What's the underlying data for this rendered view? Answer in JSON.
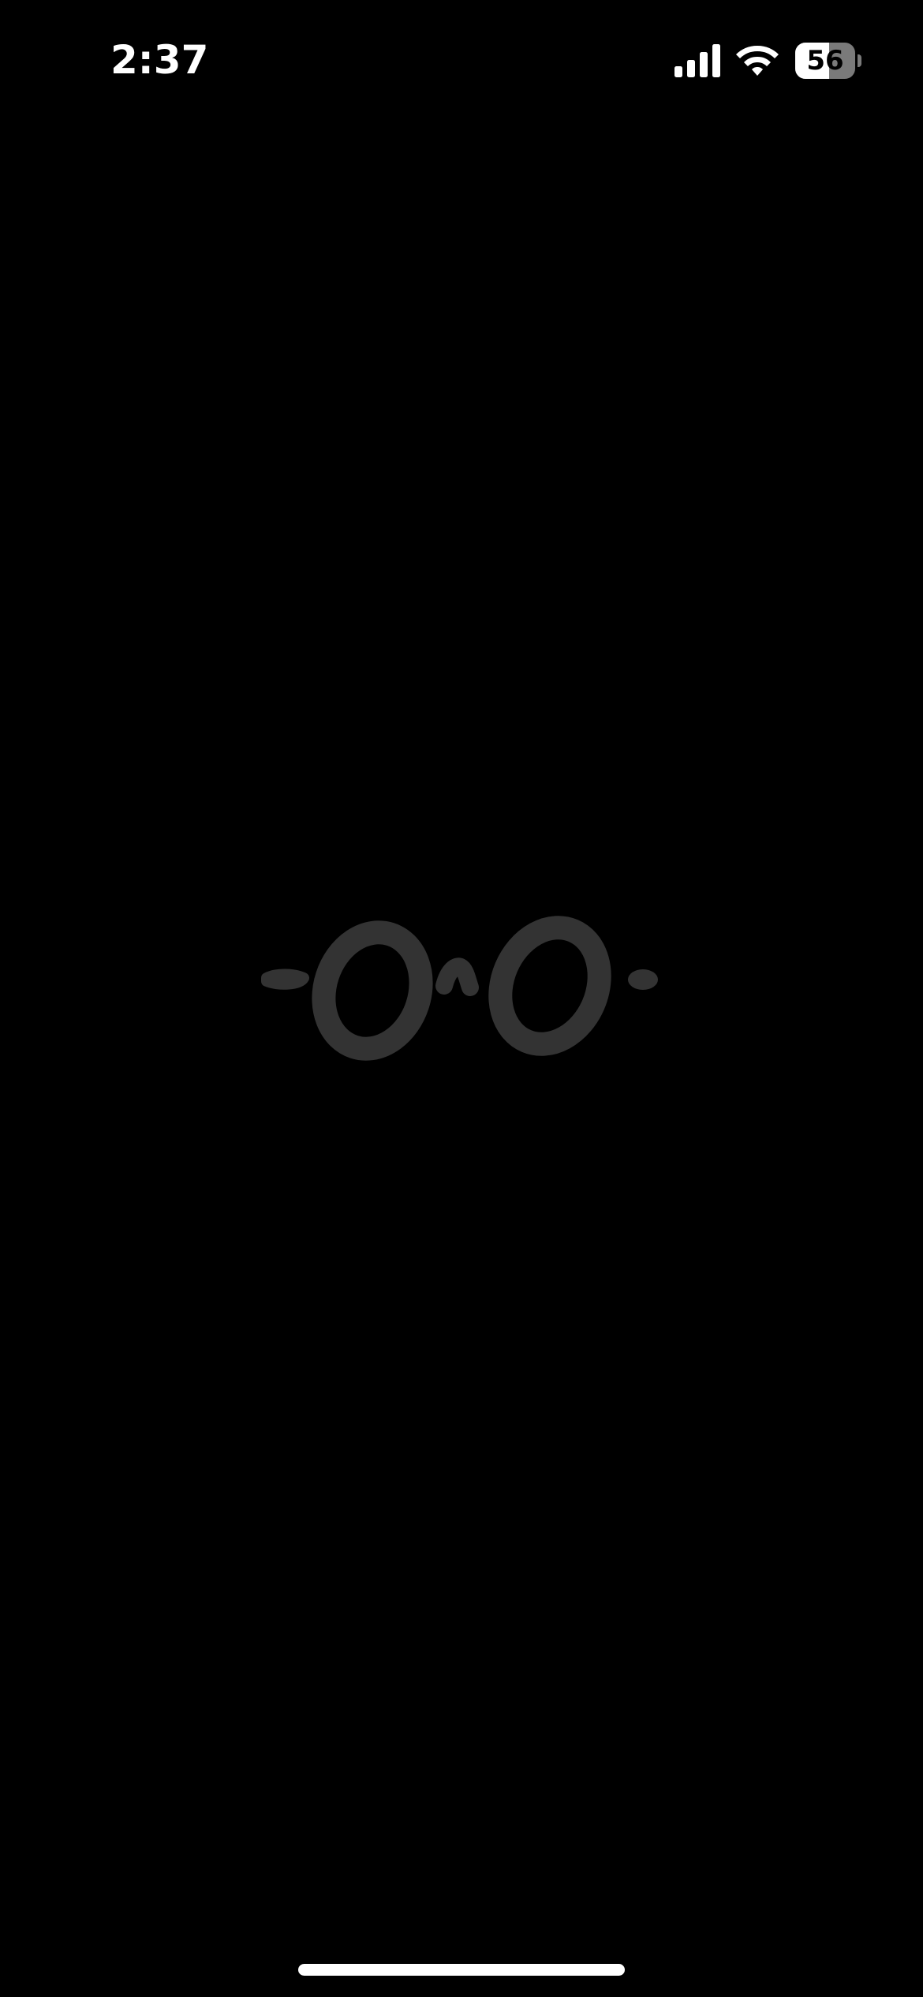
{
  "status_bar": {
    "time": "2:37",
    "battery_level": "56",
    "battery_fraction": 0.56,
    "signal_icon": "cellular-signal-icon",
    "wifi_icon": "wifi-icon"
  },
  "splash": {
    "logo_icon": "glasses-logo-icon"
  },
  "colors": {
    "background": "#000000",
    "logo": "#333333",
    "status_text": "#ffffff"
  }
}
